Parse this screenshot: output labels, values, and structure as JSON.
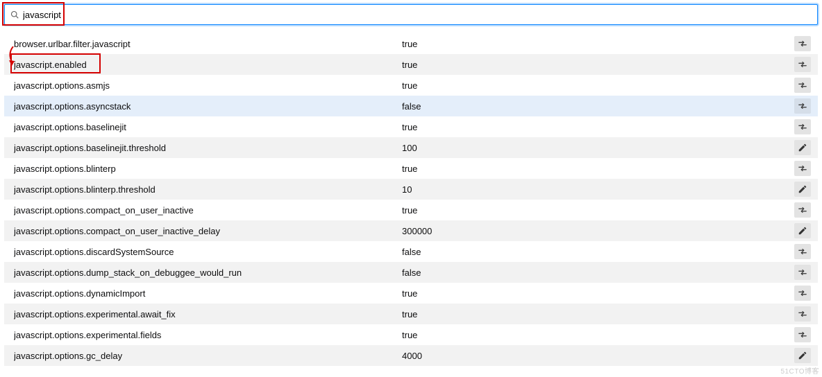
{
  "search": {
    "value": "javascript"
  },
  "annotations": {
    "search_box": true,
    "highlight_row_index": 1
  },
  "prefs": [
    {
      "name": "browser.urlbar.filter.javascript",
      "value": "true",
      "action": "toggle"
    },
    {
      "name": "javascript.enabled",
      "value": "true",
      "action": "toggle"
    },
    {
      "name": "javascript.options.asmjs",
      "value": "true",
      "action": "toggle"
    },
    {
      "name": "javascript.options.asyncstack",
      "value": "false",
      "action": "toggle",
      "selected": true
    },
    {
      "name": "javascript.options.baselinejit",
      "value": "true",
      "action": "toggle"
    },
    {
      "name": "javascript.options.baselinejit.threshold",
      "value": "100",
      "action": "edit"
    },
    {
      "name": "javascript.options.blinterp",
      "value": "true",
      "action": "toggle"
    },
    {
      "name": "javascript.options.blinterp.threshold",
      "value": "10",
      "action": "edit"
    },
    {
      "name": "javascript.options.compact_on_user_inactive",
      "value": "true",
      "action": "toggle"
    },
    {
      "name": "javascript.options.compact_on_user_inactive_delay",
      "value": "300000",
      "action": "edit"
    },
    {
      "name": "javascript.options.discardSystemSource",
      "value": "false",
      "action": "toggle"
    },
    {
      "name": "javascript.options.dump_stack_on_debuggee_would_run",
      "value": "false",
      "action": "toggle"
    },
    {
      "name": "javascript.options.dynamicImport",
      "value": "true",
      "action": "toggle"
    },
    {
      "name": "javascript.options.experimental.await_fix",
      "value": "true",
      "action": "toggle"
    },
    {
      "name": "javascript.options.experimental.fields",
      "value": "true",
      "action": "toggle"
    },
    {
      "name": "javascript.options.gc_delay",
      "value": "4000",
      "action": "edit"
    }
  ],
  "watermark": "51CTO博客"
}
